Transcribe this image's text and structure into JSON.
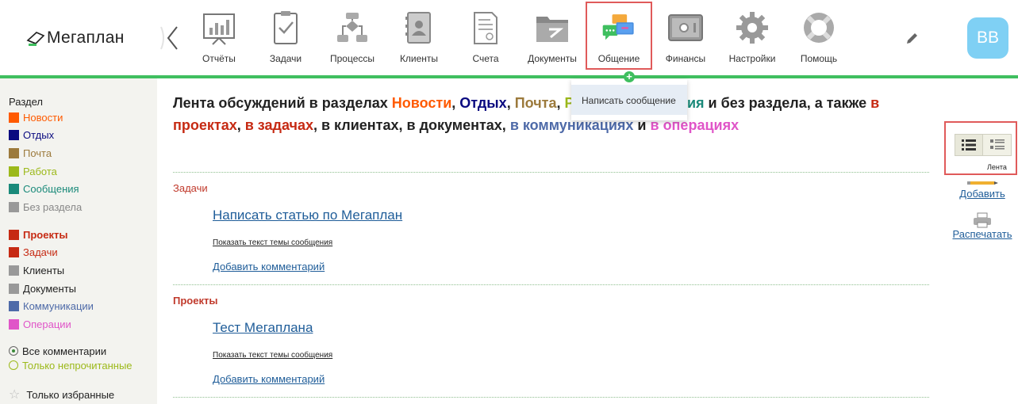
{
  "app": {
    "logo_text": "Мегаплан",
    "avatar_initials": "ВВ"
  },
  "nav": {
    "items": [
      {
        "label": "Отчёты",
        "icon": "reports-icon"
      },
      {
        "label": "Задачи",
        "icon": "tasks-icon"
      },
      {
        "label": "Процессы",
        "icon": "processes-icon"
      },
      {
        "label": "Клиенты",
        "icon": "clients-icon"
      },
      {
        "label": "Счета",
        "icon": "invoices-icon"
      },
      {
        "label": "Документы",
        "icon": "documents-icon"
      },
      {
        "label": "Общение",
        "icon": "communication-icon",
        "active": true
      },
      {
        "label": "Финансы",
        "icon": "finance-icon"
      },
      {
        "label": "Настройки",
        "icon": "settings-icon"
      },
      {
        "label": "Помощь",
        "icon": "help-icon"
      }
    ]
  },
  "dropdown": {
    "plus": "+",
    "item": "Написать сообщение"
  },
  "sidebar": {
    "heading": "Раздел",
    "sections": [
      {
        "label": "Новости",
        "color": "#ff5a00",
        "text_color": "#ff5a00"
      },
      {
        "label": "Отдых",
        "color": "#0a0a80",
        "text_color": "#0a0a80"
      },
      {
        "label": "Почта",
        "color": "#9c7a3c",
        "text_color": "#9c7a3c"
      },
      {
        "label": "Работа",
        "color": "#9cb91a",
        "text_color": "#9cb91a"
      },
      {
        "label": "Сообщения",
        "color": "#1a8a7a",
        "text_color": "#1a8a7a"
      },
      {
        "label": "Без раздела",
        "color": "#999999",
        "text_color": "#888888"
      }
    ],
    "types": [
      {
        "label": "Проекты",
        "color": "#c62a13",
        "text_color": "#c62a13",
        "bold": true
      },
      {
        "label": "Задачи",
        "color": "#c62a13",
        "text_color": "#c62a13"
      },
      {
        "label": "Клиенты",
        "color": "#999999",
        "text_color": "#222222"
      },
      {
        "label": "Документы",
        "color": "#999999",
        "text_color": "#222222"
      },
      {
        "label": "Коммуникации",
        "color": "#4e6aa8",
        "text_color": "#4e6aa8"
      },
      {
        "label": "Операции",
        "color": "#e055c8",
        "text_color": "#e055c8"
      }
    ],
    "filters": [
      {
        "label": "Все комментарии",
        "selected": true,
        "text_color": "#222222"
      },
      {
        "label": "Только непрочитанные",
        "selected": false,
        "text_color": "#9cb91a"
      }
    ],
    "favorites": "Только избранные"
  },
  "main": {
    "title_parts": [
      {
        "text": "Лента обсуждений в разделах ",
        "color": "#222222"
      },
      {
        "text": "Новости",
        "color": "#ff5a00"
      },
      {
        "text": ", ",
        "color": "#222222"
      },
      {
        "text": "Отдых",
        "color": "#0a0a80"
      },
      {
        "text": ", ",
        "color": "#222222"
      },
      {
        "text": "Почта",
        "color": "#9c7a3c"
      },
      {
        "text": ", ",
        "color": "#222222"
      },
      {
        "text": "Работа",
        "color": "#9cb91a"
      },
      {
        "text": ", ",
        "color": "#222222"
      },
      {
        "text": "Сообщения",
        "color": "#1a8a7a"
      },
      {
        "text": " и без раздела, а также ",
        "color": "#222222"
      },
      {
        "text": "в проектах",
        "color": "#c62a13"
      },
      {
        "text": ", ",
        "color": "#222222"
      },
      {
        "text": "в задачах",
        "color": "#c62a13"
      },
      {
        "text": ", в клиентах, в документах, ",
        "color": "#222222"
      },
      {
        "text": "в коммуникациях",
        "color": "#4e6aa8"
      },
      {
        "text": " и ",
        "color": "#222222"
      },
      {
        "text": "в операциях",
        "color": "#e055c8"
      }
    ],
    "groups": [
      {
        "label": "Задачи",
        "topic": "Написать статью по Мегаплан",
        "show_text": "Показать текст темы сообщения",
        "add_comment": "Добавить комментарий"
      },
      {
        "label": "Проекты",
        "topic": "Тест Мегаплана",
        "show_text": "Показать текст темы сообщения",
        "add_comment": "Добавить комментарий"
      }
    ]
  },
  "right_panel": {
    "view_label": "Лента",
    "add_label": "Добавить",
    "print_label": "Распечатать"
  },
  "colors": {
    "accent_green": "#3fbf5f",
    "highlight_red": "#e05a5a",
    "link_blue": "#1f5d99",
    "avatar_bg": "#7fd0f4"
  }
}
